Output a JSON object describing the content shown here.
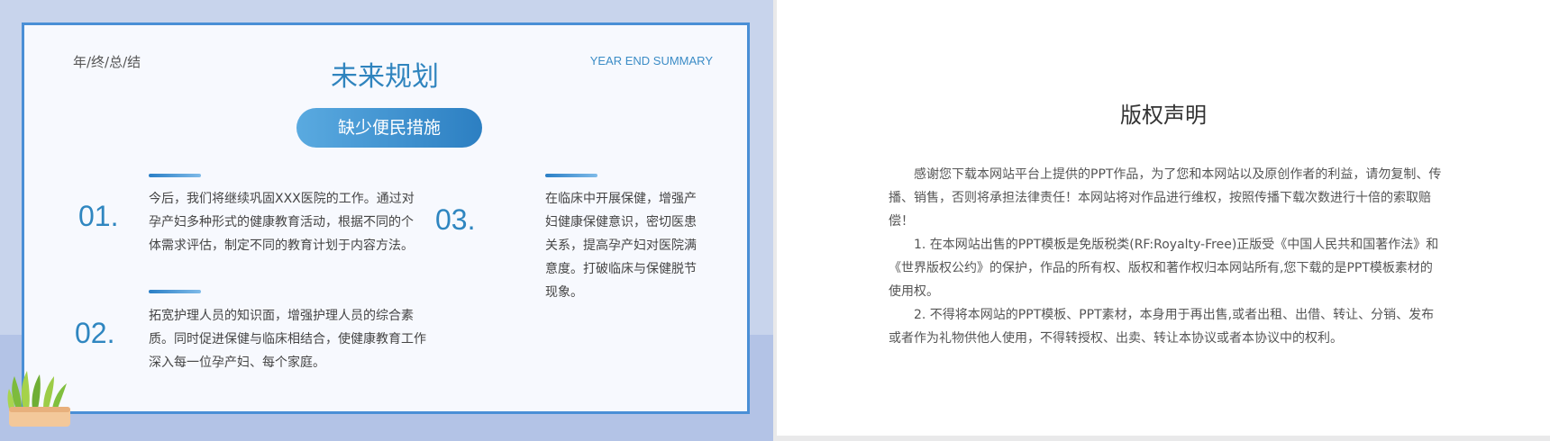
{
  "left_slide": {
    "year_label": "年/终/总/结",
    "title": "未来规划",
    "subtitle_en": "YEAR END SUMMARY",
    "pill_label": "缺少便民措施",
    "items": [
      {
        "number": "01.",
        "text": "今后，我们将继续巩固XXX医院的工作。通过对孕产妇多种形式的健康教育活动，根据不同的个体需求评估，制定不同的教育计划于内容方法。"
      },
      {
        "number": "02.",
        "text": "拓宽护理人员的知识面，增强护理人员的综合素质。同时促进保健与临床相结合，使健康教育工作深入每一位孕产妇、每个家庭。"
      },
      {
        "number": "03.",
        "text": "在临床中开展保健，增强产妇健康保健意识，密切医患关系，提高孕产妇对医院满意度。打破临床与保健脱节现象。"
      }
    ]
  },
  "right_slide": {
    "title": "版权声明",
    "paragraphs": [
      "感谢您下载本网站平台上提供的PPT作品，为了您和本网站以及原创作者的利益，请勿复制、传播、销售，否则将承担法律责任！本网站将对作品进行维权，按照传播下载次数进行十倍的索取赔偿！",
      "1. 在本网站出售的PPT模板是免版税类(RF:Royalty-Free)正版受《中国人民共和国著作法》和《世界版权公约》的保护，作品的所有权、版权和著作权归本网站所有,您下载的是PPT模板素材的使用权。",
      "2. 不得将本网站的PPT模板、PPT素材，本身用于再出售,或者出租、出借、转让、分销、发布或者作为礼物供他人使用，不得转授权、出卖、转让本协议或者本协议中的权利。"
    ]
  },
  "colors": {
    "accent": "#2f84be",
    "card_border": "#4a8fd6",
    "slide_bg": "#c8d4ec"
  }
}
